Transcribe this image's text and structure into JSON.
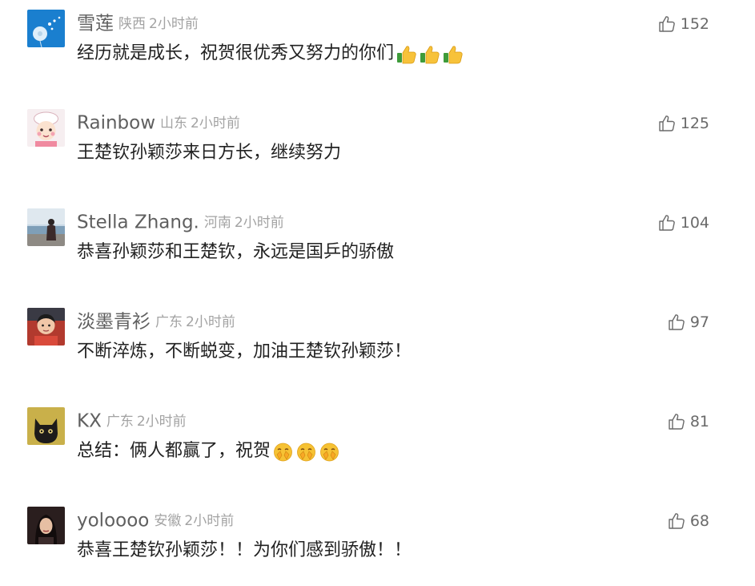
{
  "comments": [
    {
      "username": "雪莲",
      "location": "陕西",
      "time": "2小时前",
      "text": "经历就是成长，祝贺很优秀又努力的你们",
      "emojis": [
        "thumbs-up",
        "thumbs-up",
        "thumbs-up"
      ],
      "likes": "152",
      "avatar": "dandelion-avatar"
    },
    {
      "username": "Rainbow",
      "location": "山东",
      "time": "2小时前",
      "text": "王楚钦孙颖莎来日方长，继续努力",
      "emojis": [],
      "likes": "125",
      "avatar": "cartoon-chef-avatar"
    },
    {
      "username": "Stella Zhang.",
      "location": "河南",
      "time": "2小时前",
      "text": "恭喜孙颖莎和王楚钦，永远是国乒的骄傲",
      "emojis": [],
      "likes": "104",
      "avatar": "seaside-person-avatar"
    },
    {
      "username": "淡墨青衫",
      "location": "广东",
      "time": "2小时前",
      "text": "不断淬炼，不断蜕变，加油王楚钦孙颖莎！",
      "emojis": [],
      "likes": "97",
      "avatar": "child-photo-avatar"
    },
    {
      "username": "KX",
      "location": "广东",
      "time": "2小时前",
      "text": "总结：俩人都赢了，祝贺",
      "emojis": [
        "clapping-face",
        "clapping-face",
        "clapping-face"
      ],
      "likes": "81",
      "avatar": "black-cat-avatar"
    },
    {
      "username": "yoloooo",
      "location": "安徽",
      "time": "2小时前",
      "text": "恭喜王楚钦孙颖莎！！为你们感到骄傲！！",
      "emojis": [],
      "likes": "68",
      "avatar": "woman-portrait-avatar"
    }
  ],
  "colors": {
    "username": "#5f5f5f",
    "meta": "#a3a3a3",
    "content": "#222222",
    "like": "#6a6a6a"
  }
}
